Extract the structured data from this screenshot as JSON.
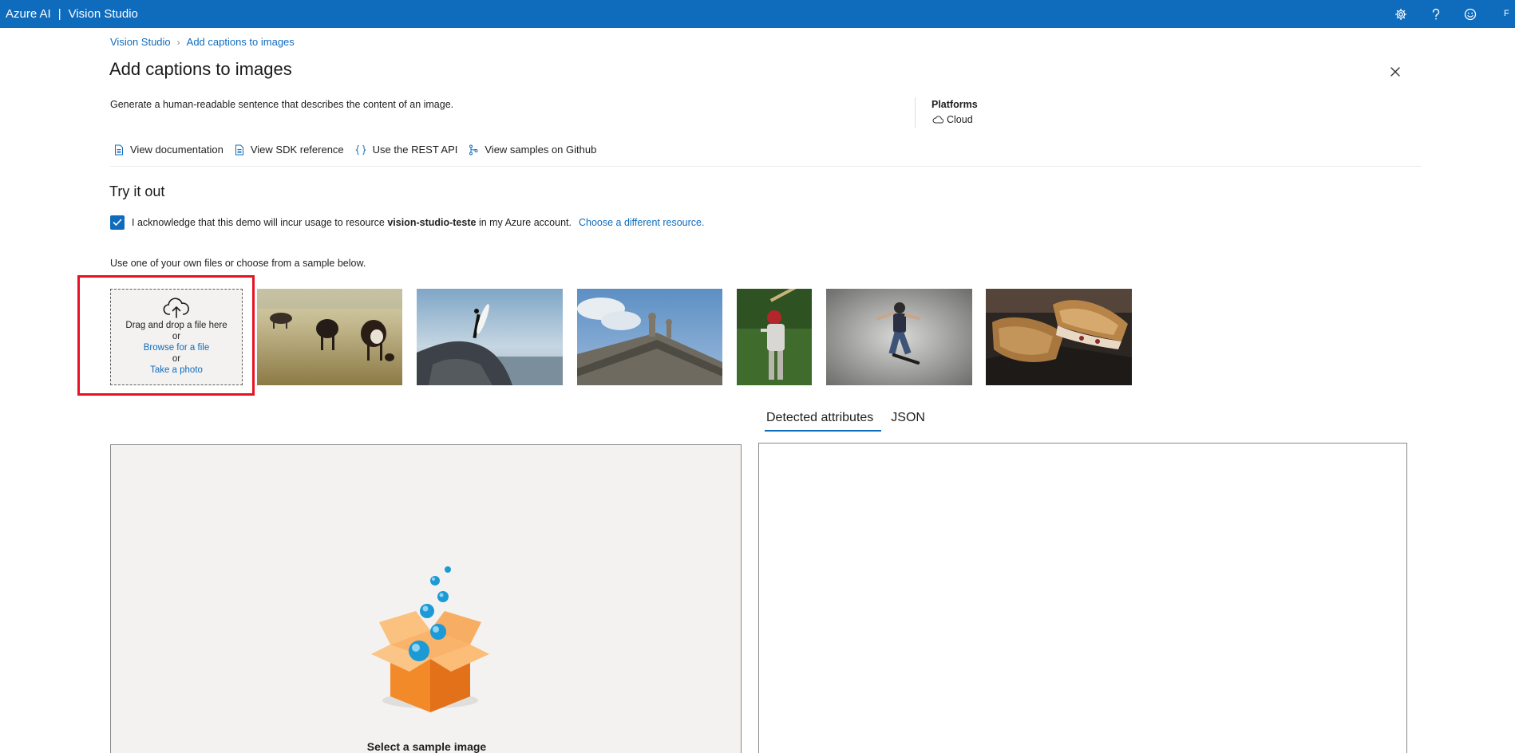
{
  "header": {
    "brand": "Azure AI",
    "separator": "|",
    "product": "Vision Studio",
    "icons": [
      "gear-icon",
      "help-icon",
      "feedback-smiley-icon"
    ],
    "user_initial": "F"
  },
  "breadcrumb": {
    "home": "Vision Studio",
    "current": "Add captions to images"
  },
  "page": {
    "title": "Add captions to images",
    "description": "Generate a human-readable sentence that describes the content of an image.",
    "platforms_title": "Platforms",
    "platform": "Cloud"
  },
  "links": {
    "documentation": "View documentation",
    "sdk": "View SDK reference",
    "rest": "Use the REST API",
    "github": "View samples on Github"
  },
  "try_it": {
    "title": "Try it out",
    "ack_prefix": "I acknowledge that this demo will incur usage to resource",
    "resource_name": "vision-studio-teste",
    "ack_suffix": "in my Azure account.",
    "change_resource": "Choose a different resource.",
    "checked": true,
    "use_text": "Use one of your own files or choose from a sample below."
  },
  "dropzone": {
    "drag": "Drag and drop a file here",
    "or1": "or",
    "browse": "Browse for a file",
    "or2": "or",
    "photo": "Take a photo"
  },
  "tabs": {
    "detected": "Detected attributes",
    "json": "JSON",
    "active": "detected"
  },
  "panel": {
    "select_text": "Select a sample image"
  },
  "colors": {
    "accent": "#0f6cbd",
    "highlight": "#e81123"
  }
}
